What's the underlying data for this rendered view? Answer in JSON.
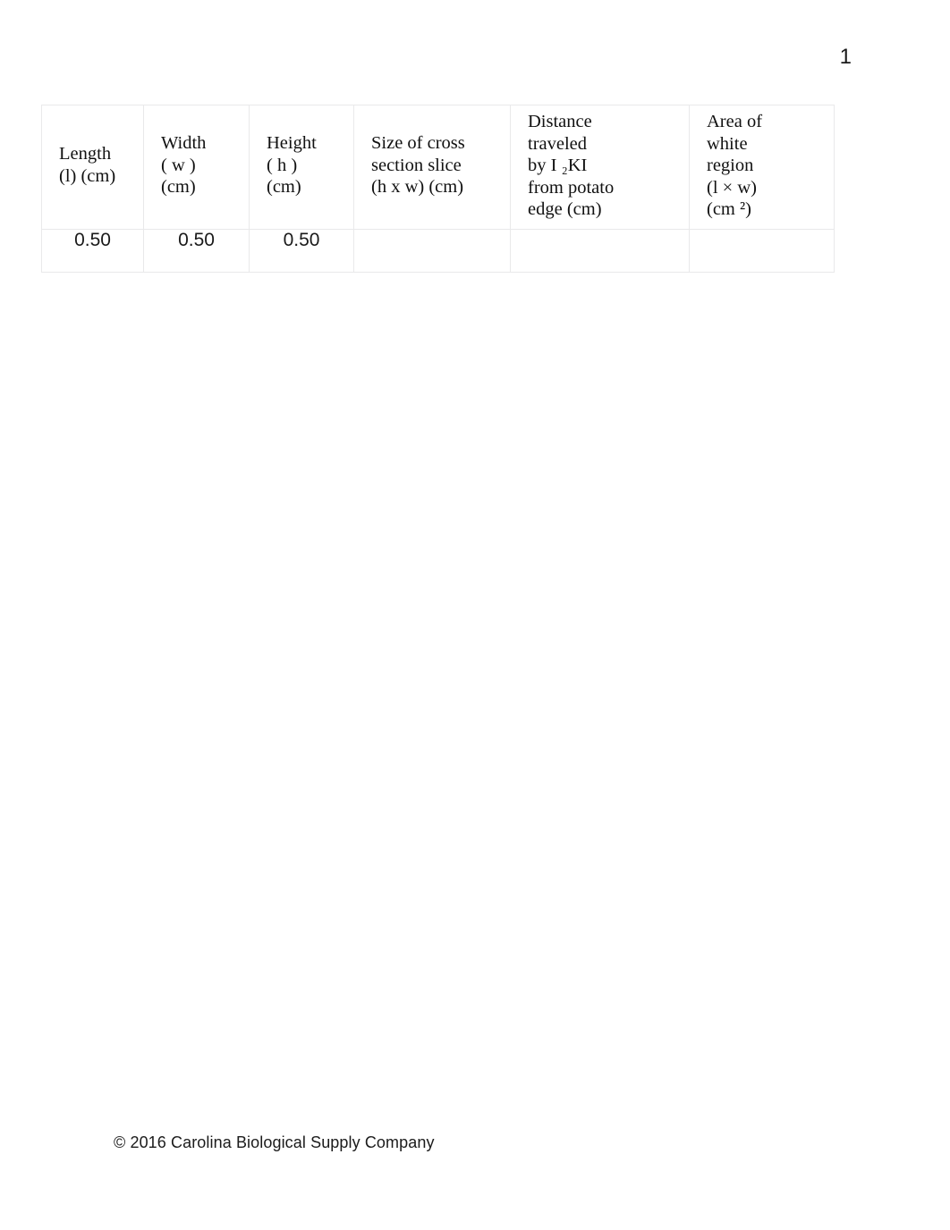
{
  "document": {
    "page_number": "1",
    "footer": "© 2016 Carolina Biological Supply Company"
  },
  "table": {
    "name": "potato-diffusion-measurements",
    "headers": [
      {
        "id": "length",
        "lines": [
          "Length",
          "(l) (cm)"
        ],
        "size_class": "short"
      },
      {
        "id": "width",
        "lines": [
          "Width",
          "( w )",
          "(cm)"
        ],
        "size_class": "medium"
      },
      {
        "id": "height",
        "lines": [
          "Height",
          "( h )",
          "(cm)"
        ],
        "size_class": "medium"
      },
      {
        "id": "cross-section-size",
        "lines": [
          "Size of cross",
          "section slice",
          "(h x w) (cm)"
        ],
        "size_class": "medium"
      },
      {
        "id": "distance-traveled",
        "lines": [
          "Distance",
          "traveled",
          "by I ₂KI",
          "from potato",
          "edge (cm)"
        ],
        "size_class": "tall"
      },
      {
        "id": "white-region-area",
        "lines": [
          "Area of",
          "white",
          "region",
          "(l × w)",
          "(cm ²)"
        ],
        "size_class": "tall"
      }
    ],
    "rows": [
      {
        "cells": [
          "0.50",
          "0.50",
          "0.50",
          "",
          "",
          ""
        ]
      }
    ]
  },
  "colors": {
    "page_background": "#ffffff",
    "text": "#111111",
    "table_border": "#e9e9ea"
  }
}
